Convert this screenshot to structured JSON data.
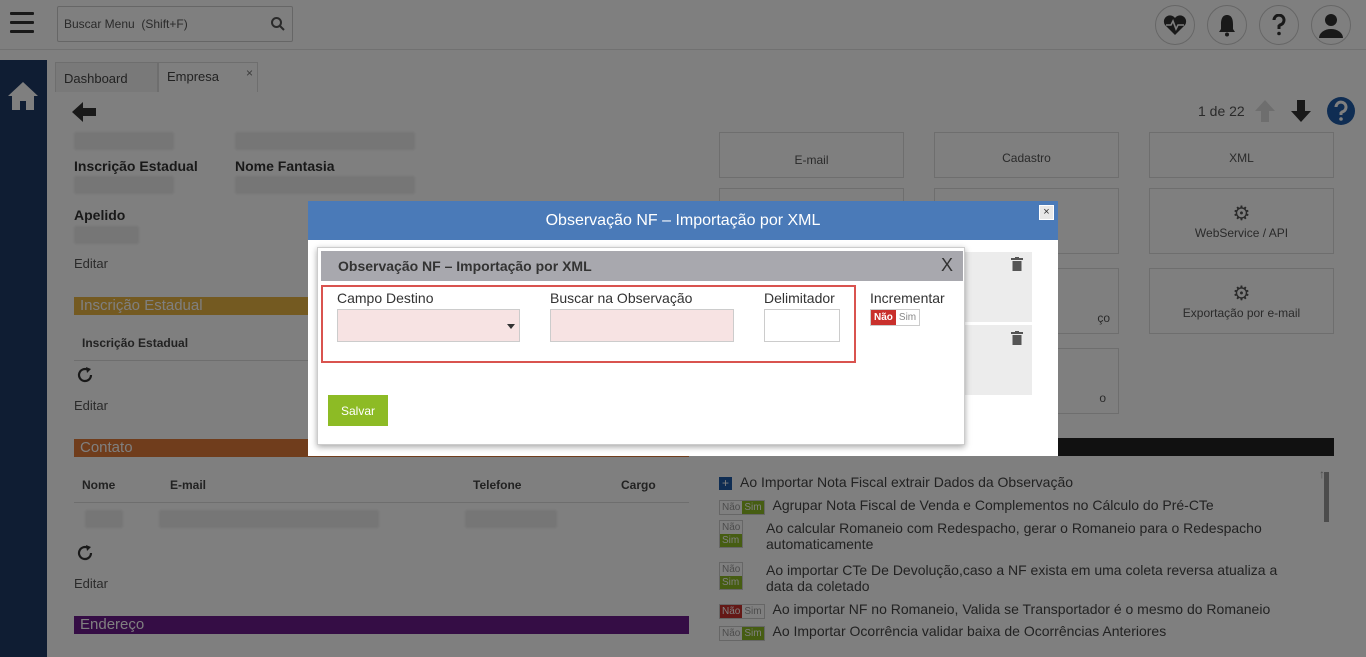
{
  "topbar": {
    "search_placeholder": "Buscar Menu  (Shift+F)"
  },
  "tabs": [
    {
      "label": "Dashboard"
    },
    {
      "label": "Empresa",
      "close": "×"
    }
  ],
  "pager": {
    "text": "1 de 22"
  },
  "form": {
    "ie_label": "Inscrição Estadual",
    "nome_fantasia_label": "Nome Fantasia",
    "apelido_label": "Apelido",
    "editar": "Editar",
    "section_ie": "Inscrição Estadual",
    "col_ie": "Inscrição Estadual",
    "section_contato": "Contato",
    "col_nome": "Nome",
    "col_email": "E-mail",
    "col_telefone": "Telefone",
    "col_cargo": "Cargo",
    "section_endereco": "Endereço"
  },
  "cards": {
    "email": "E-mail",
    "cadastro": "Cadastro",
    "xml": "XML",
    "webservice": "WebService / API",
    "exportacao": "Exportação por e-mail",
    "partial1": "ço",
    "partial2": "o"
  },
  "options": {
    "header": "Ao Importar Nota Fiscal extrair Dados da Observação",
    "items": [
      {
        "text": "Agrupar Nota Fiscal de Venda e Complementos no Cálculo do Pré-CTe"
      },
      {
        "text": "Ao calcular Romaneio com Redespacho, gerar o Romaneio para o Redespacho",
        "text2": "automaticamente"
      },
      {
        "text": "Ao importar CTe De Devolução,caso a NF exista em uma coleta reversa atualiza a",
        "text2": "data da coletado"
      },
      {
        "text": "Ao importar NF no Romaneio, Valida se Transportador é o mesmo do Romaneio"
      },
      {
        "text": "Ao Importar Ocorrência validar baixa de Ocorrências Anteriores"
      }
    ],
    "nao": "Não",
    "sim": "Sim"
  },
  "dialog": {
    "title": "Observação NF – Importação por XML",
    "close": "×"
  },
  "inner": {
    "title": "Observação NF – Importação por XML",
    "close": "X",
    "campo_destino": "Campo Destino",
    "buscar": "Buscar na Observação",
    "delimitador": "Delimitador",
    "incrementar": "Incrementar",
    "nao": "Não",
    "sim": "Sim",
    "save": "Salvar"
  },
  "colors": {
    "rail": "#1f3a66",
    "dialog_header": "#4a7ab8",
    "ie_section": "#e8b443",
    "contato_section": "#e07b39",
    "endereco_section": "#6a1b8a",
    "save_button": "#8dbb25",
    "nao_active": "#c9302c",
    "sim_active": "#8dbb25"
  }
}
